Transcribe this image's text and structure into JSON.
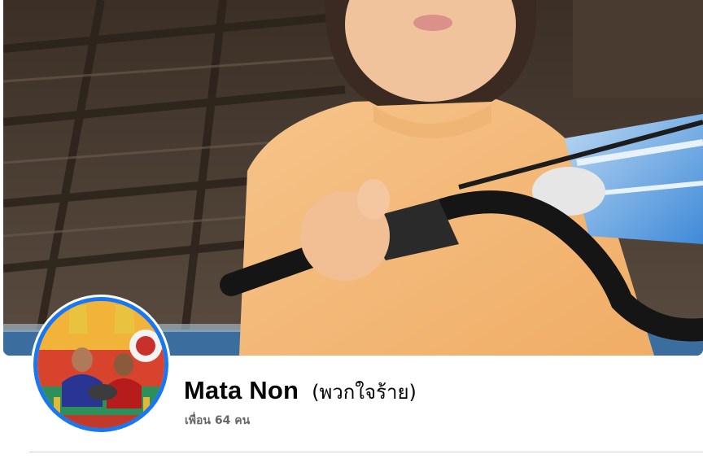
{
  "profile": {
    "name": "Mata Non",
    "alternate_name": "(พวกใจร้าย)",
    "friends_count": "เพื่อน 64 คน"
  },
  "colors": {
    "accent": "#1877f2",
    "name_text": "#050505",
    "secondary_text": "#65676b",
    "divider": "#ced0d4"
  }
}
